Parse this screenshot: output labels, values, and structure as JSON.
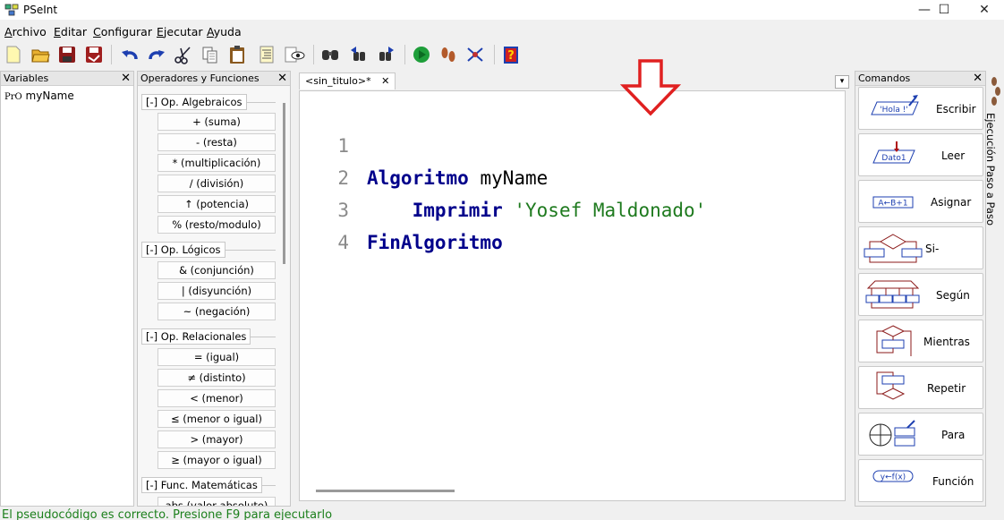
{
  "app": {
    "title": "PSeInt"
  },
  "window_controls": {
    "minimize": "—",
    "maximize": "☐",
    "close": "✕"
  },
  "menu": [
    {
      "label": "Archivo",
      "mn": "A",
      "rest": "rchivo"
    },
    {
      "label": "Editar",
      "mn": "E",
      "rest": "ditar"
    },
    {
      "label": "Configurar",
      "mn": "C",
      "rest": "onfigurar"
    },
    {
      "label": "Ejecutar",
      "mn": "E",
      "rest": "jecutar"
    },
    {
      "label": "Ayuda",
      "mn": "A",
      "rest": "yuda"
    }
  ],
  "toolbar_icons": [
    "new-file-icon",
    "open-folder-icon",
    "save-icon",
    "save-as-icon",
    "undo-icon",
    "redo-icon",
    "cut-icon",
    "copy-icon",
    "paste-icon",
    "format-icon",
    "preview-icon",
    "search-icon",
    "search-prev-icon",
    "search-next-icon",
    "run-icon",
    "step-icon",
    "debug-icon",
    "help-icon"
  ],
  "variables": {
    "title": "Variables",
    "items": [
      {
        "tag": "PrO",
        "name": "myName"
      }
    ]
  },
  "operators": {
    "title": "Operadores y Funciones",
    "groups": [
      {
        "label": "Op. Algebraicos",
        "items": [
          "+ (suma)",
          "- (resta)",
          "* (multiplicación)",
          "/ (división)",
          "↑ (potencia)",
          "% (resto/modulo)"
        ]
      },
      {
        "label": "Op. Lógicos",
        "items": [
          "& (conjunción)",
          "| (disyunción)",
          "~ (negación)"
        ]
      },
      {
        "label": "Op. Relacionales",
        "items": [
          "= (igual)",
          "≠ (distinto)",
          "< (menor)",
          "≤ (menor o igual)",
          "> (mayor)",
          "≥ (mayor o igual)"
        ]
      },
      {
        "label": "Func. Matemáticas",
        "items": [
          "abs (valor absoluto)"
        ]
      }
    ],
    "toggle": "[-]"
  },
  "editor": {
    "tab": "<sin_titulo>*",
    "tab_close": "✕",
    "lines": [
      {
        "n": "1",
        "kw": "Algoritmo",
        "rest": " myName",
        "str": ""
      },
      {
        "n": "2",
        "kw": "    Imprimir",
        "rest": " ",
        "str": "'Yosef Maldonado'"
      },
      {
        "n": "3",
        "kw": "FinAlgoritmo",
        "rest": "",
        "str": ""
      },
      {
        "n": "4",
        "kw": "",
        "rest": "",
        "str": ""
      }
    ]
  },
  "commands": {
    "title": "Comandos",
    "items": [
      {
        "label": "Escribir",
        "icon": "write-icon",
        "inner": "'Hola !'"
      },
      {
        "label": "Leer",
        "icon": "read-icon",
        "inner": "Dato1"
      },
      {
        "label": "Asignar",
        "icon": "assign-icon",
        "inner": "A←B+1"
      },
      {
        "label": "Si-Entonces",
        "icon": "if-icon",
        "inner": ""
      },
      {
        "label": "Según",
        "icon": "switch-icon",
        "inner": ""
      },
      {
        "label": "Mientras",
        "icon": "while-icon",
        "inner": ""
      },
      {
        "label": "Repetir",
        "icon": "repeat-icon",
        "inner": ""
      },
      {
        "label": "Para",
        "icon": "for-icon",
        "inner": ""
      },
      {
        "label": "Función",
        "icon": "function-icon",
        "inner": "y←f(x)"
      }
    ]
  },
  "side_tab": {
    "label": "Ejecución Paso a Paso"
  },
  "status": {
    "text": "El pseudocódigo es correcto. Presione F9 para ejecutarlo"
  },
  "colors": {
    "keyword": "#00008b",
    "string": "#1e7a1e",
    "arrow": "#e02020",
    "status": "#1b7f1b"
  }
}
